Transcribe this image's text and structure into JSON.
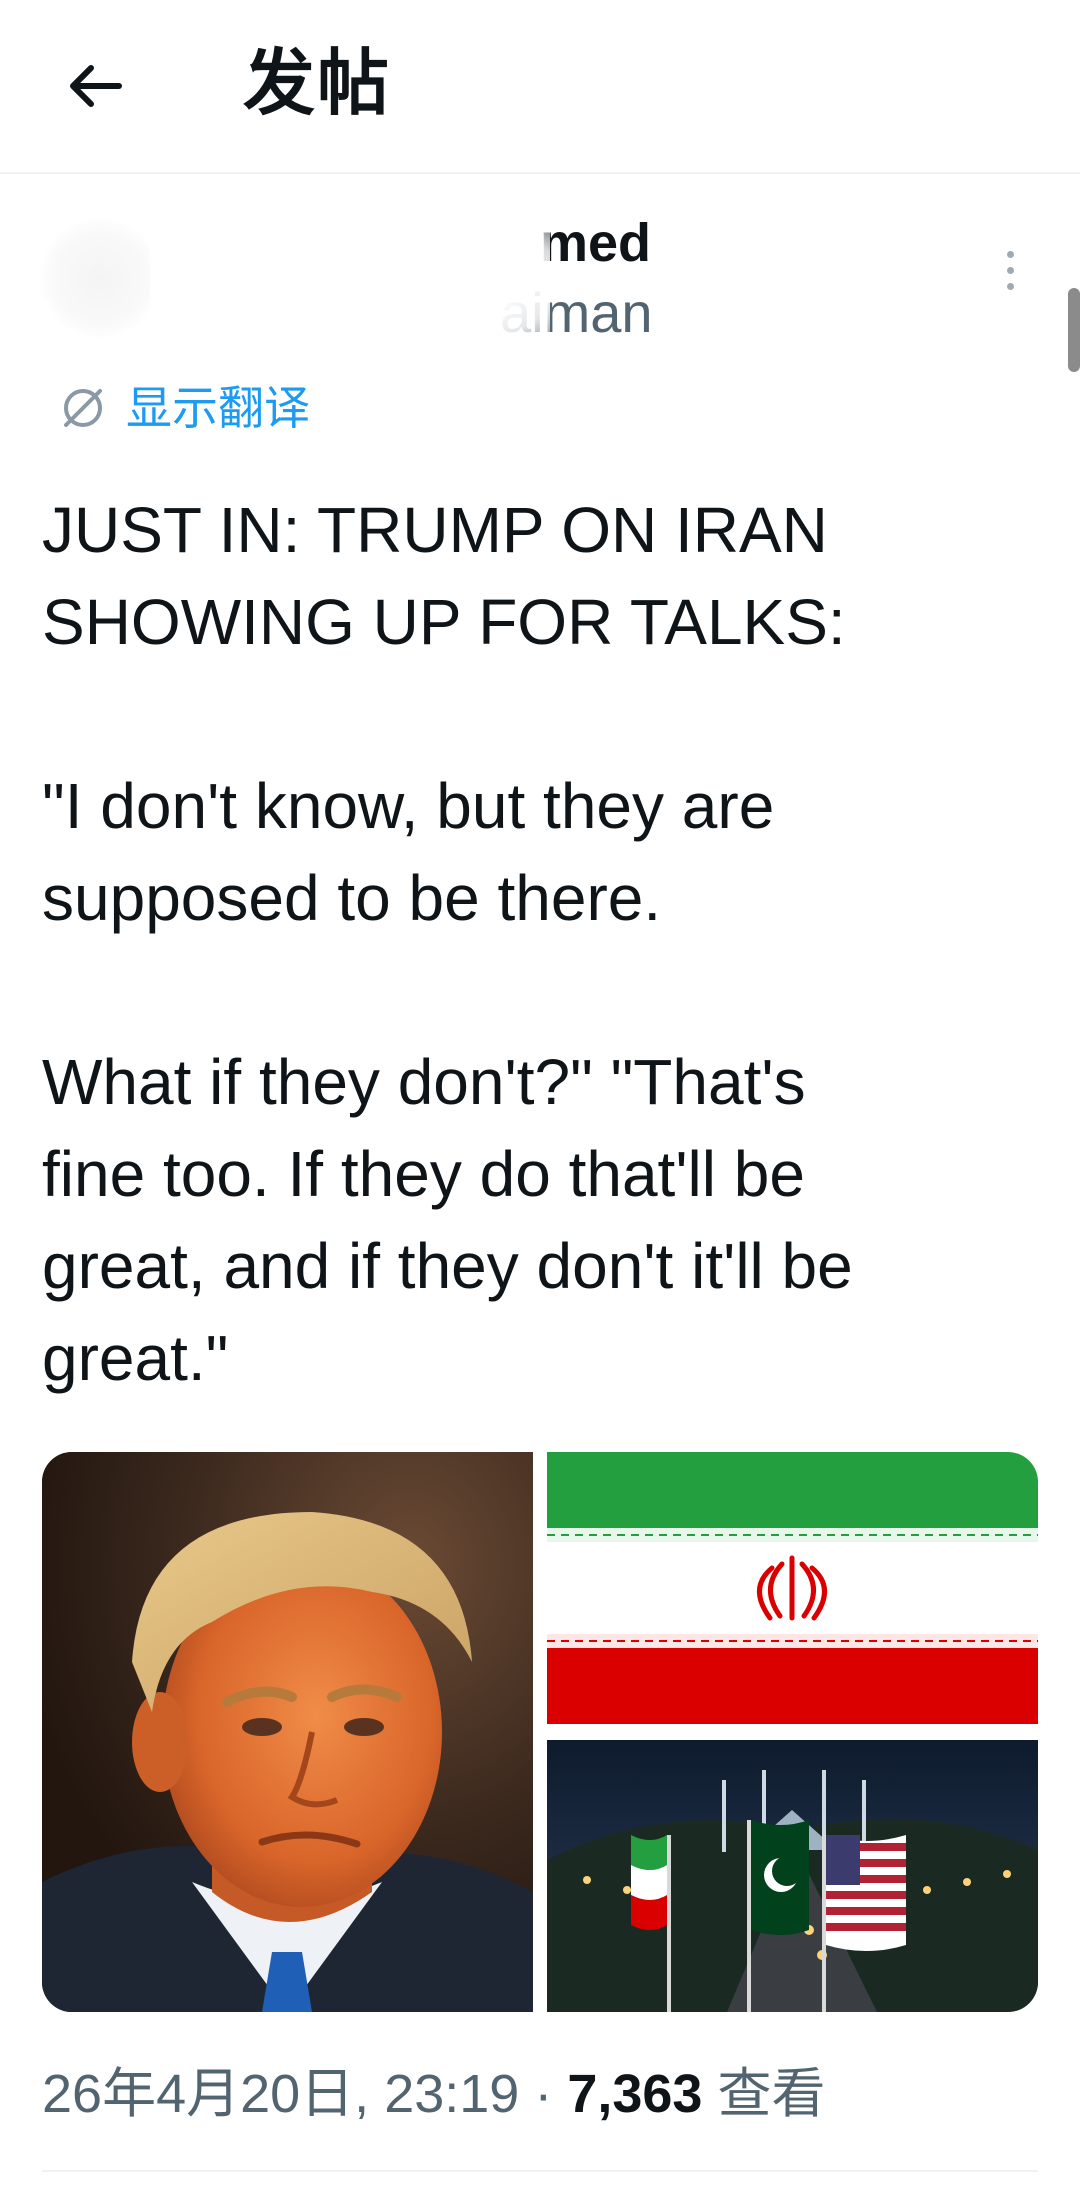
{
  "header": {
    "title": "发帖",
    "back_icon": "arrow-left-icon"
  },
  "author": {
    "name_visible": "med",
    "handle_visible": "aiman"
  },
  "translate": {
    "label": "显示翻译",
    "icon": "translate-globe-icon"
  },
  "tweet": {
    "paragraphs": [
      "JUST IN: TRUMP ON IRAN\nSHOWING UP FOR TALKS:",
      "\"I don't know, but they are\nsupposed to be there.",
      "What if they don't?\" \"That's\nfine too. If they do that'll be\ngreat, and if they don't it'll be\ngreat.\""
    ]
  },
  "media": {
    "left_icon": "portrait-photo",
    "top_right_icon": "iran-flag-photo",
    "bottom_right_icon": "flags-avenue-photo"
  },
  "meta": {
    "date": "26年4月20日",
    "time": "23:19",
    "separator": " · ",
    "views_count": "7,363",
    "views_label": "查看"
  },
  "colors": {
    "text_primary": "#0f1419",
    "text_secondary": "#536471",
    "accent": "#1d9bf0",
    "divider": "#eff3f4"
  }
}
